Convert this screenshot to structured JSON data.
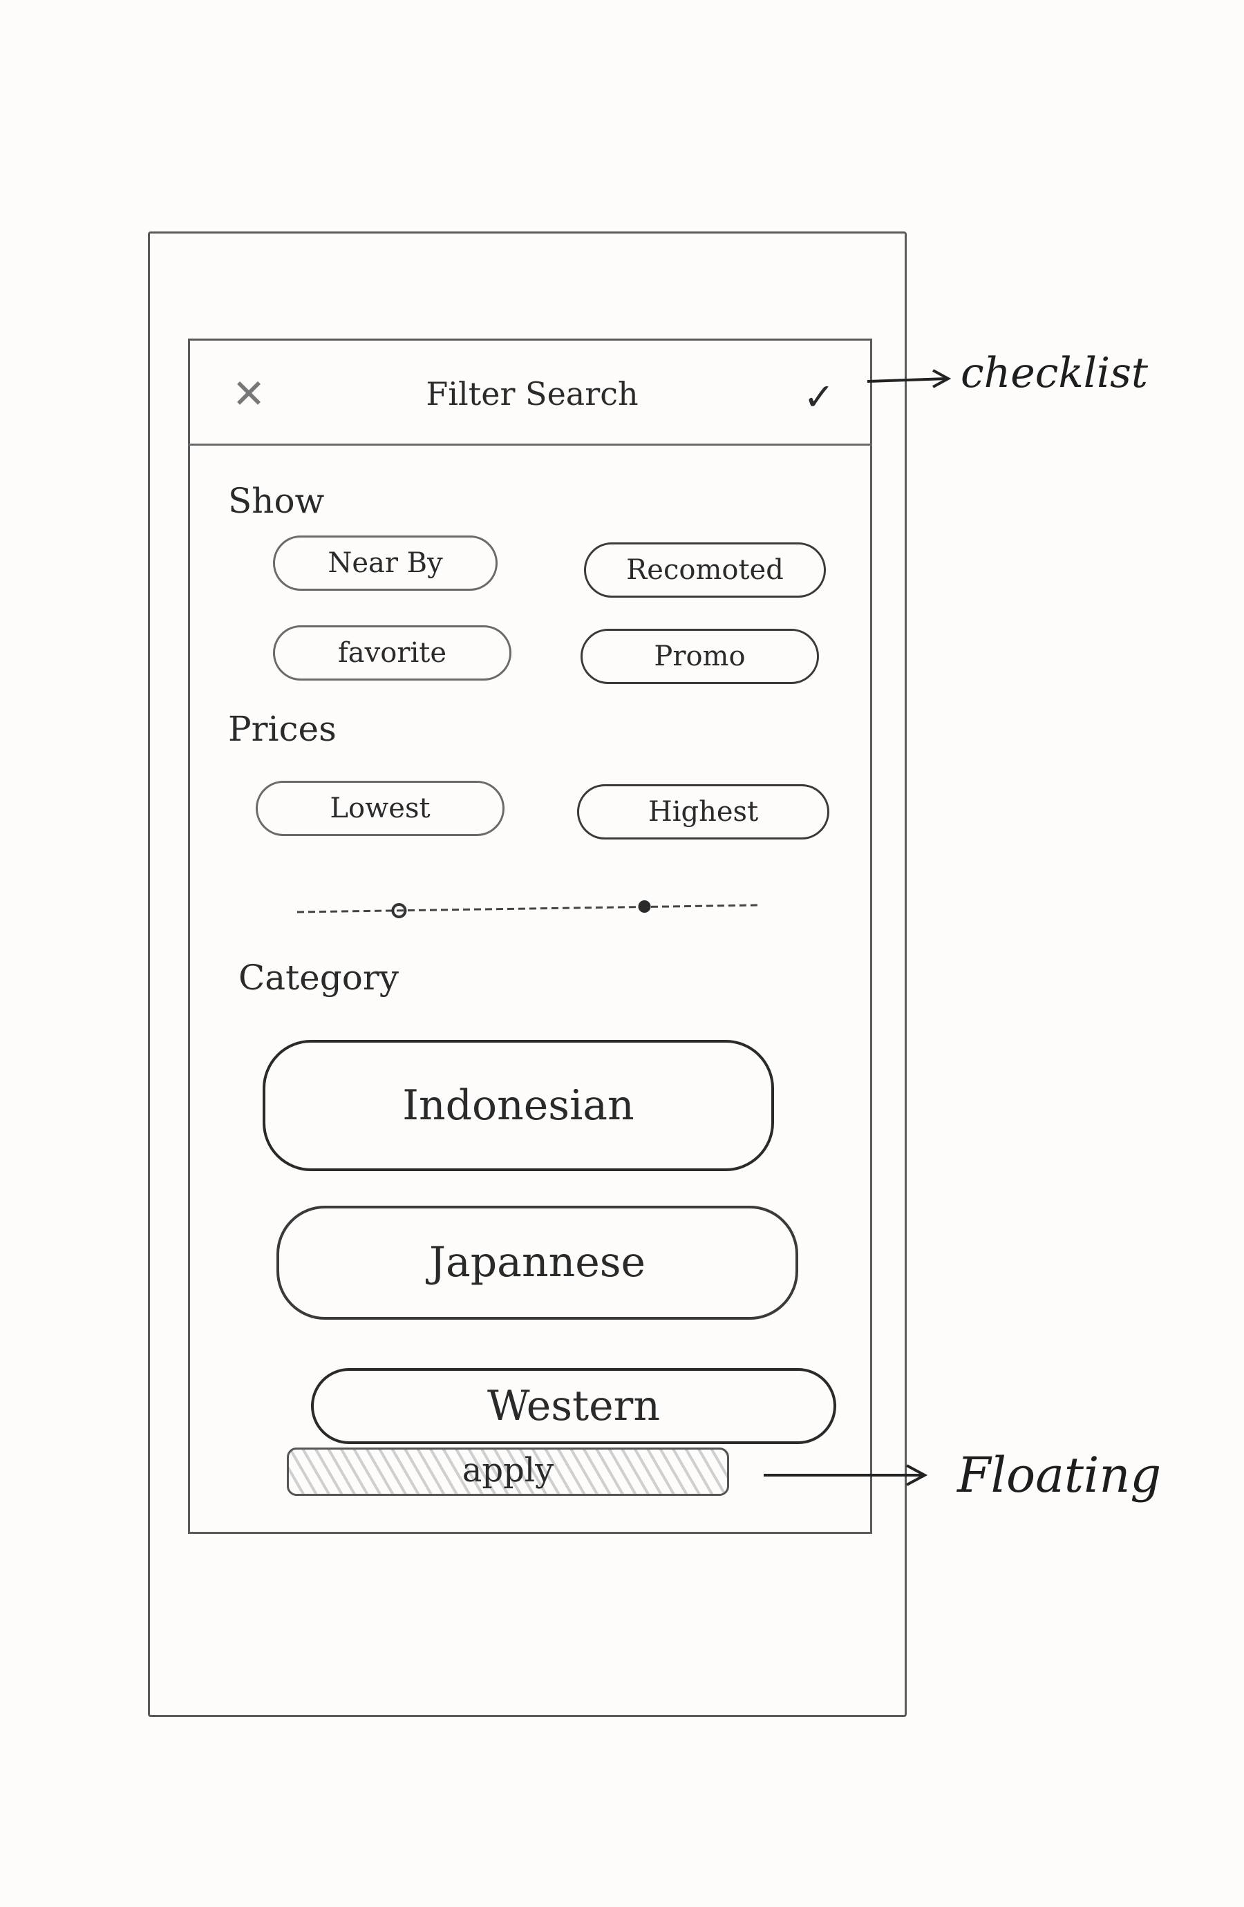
{
  "header": {
    "close_icon": "close-icon",
    "title": "Filter Search",
    "check_icon": "check-icon"
  },
  "sections": {
    "show": {
      "label": "Show",
      "chips": [
        "Near By",
        "Recomoted",
        "favorite",
        "Promo"
      ]
    },
    "prices": {
      "label": "Prices",
      "chips": [
        "Lowest",
        "Highest"
      ],
      "slider": {
        "min_fraction": 0.22,
        "max_fraction": 0.75
      }
    },
    "category": {
      "label": "Category",
      "items": [
        "Indonesian",
        "Japannese",
        "Western"
      ]
    }
  },
  "apply_button": {
    "label": "apply"
  },
  "annotations": {
    "checklist": "checklist",
    "floating": "Floating"
  }
}
